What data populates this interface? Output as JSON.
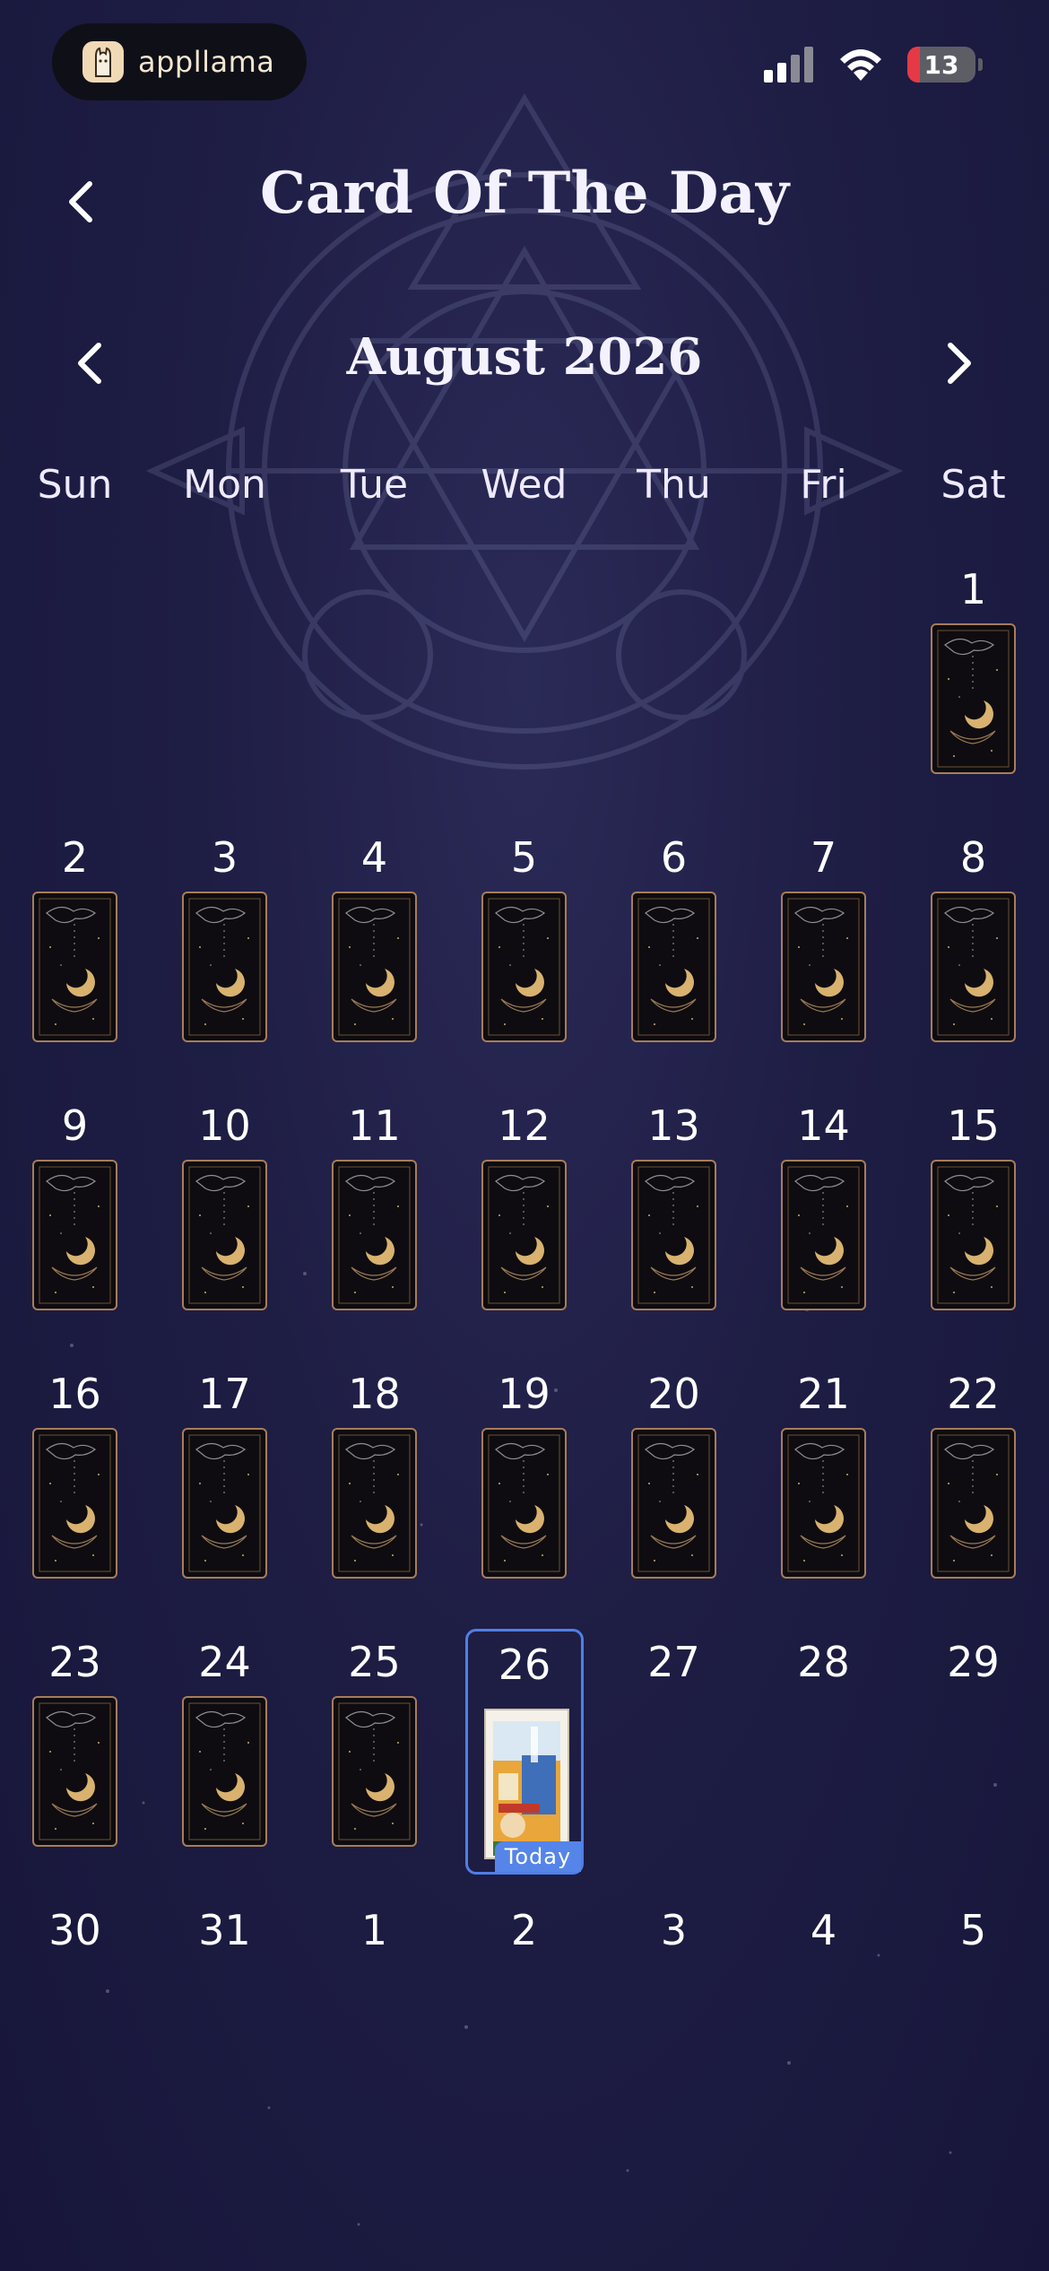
{
  "status_bar": {
    "brand": "appllama",
    "battery": "13"
  },
  "header": {
    "title": "Card Of The Day"
  },
  "calendar": {
    "month_label": "August 2026",
    "weekdays": [
      "Sun",
      "Mon",
      "Tue",
      "Wed",
      "Thu",
      "Fri",
      "Sat"
    ],
    "today_label": "Today",
    "today_date": "26",
    "colors": {
      "accent": "#4f7fe6",
      "today_badge": "#5585e8",
      "card_border": "#a77d58",
      "card_gold": "#d8b26e"
    },
    "weeks": [
      [
        {
          "day": "",
          "state": "empty"
        },
        {
          "day": "",
          "state": "empty"
        },
        {
          "day": "",
          "state": "empty"
        },
        {
          "day": "",
          "state": "empty"
        },
        {
          "day": "",
          "state": "empty"
        },
        {
          "day": "",
          "state": "empty"
        },
        {
          "day": "1",
          "state": "card"
        }
      ],
      [
        {
          "day": "2",
          "state": "card"
        },
        {
          "day": "3",
          "state": "card"
        },
        {
          "day": "4",
          "state": "card"
        },
        {
          "day": "5",
          "state": "card"
        },
        {
          "day": "6",
          "state": "card"
        },
        {
          "day": "7",
          "state": "card"
        },
        {
          "day": "8",
          "state": "card"
        }
      ],
      [
        {
          "day": "9",
          "state": "card"
        },
        {
          "day": "10",
          "state": "card"
        },
        {
          "day": "11",
          "state": "card"
        },
        {
          "day": "12",
          "state": "card"
        },
        {
          "day": "13",
          "state": "card"
        },
        {
          "day": "14",
          "state": "card"
        },
        {
          "day": "15",
          "state": "card"
        }
      ],
      [
        {
          "day": "16",
          "state": "card"
        },
        {
          "day": "17",
          "state": "card"
        },
        {
          "day": "18",
          "state": "card"
        },
        {
          "day": "19",
          "state": "card"
        },
        {
          "day": "20",
          "state": "card"
        },
        {
          "day": "21",
          "state": "card"
        },
        {
          "day": "22",
          "state": "card"
        }
      ],
      [
        {
          "day": "23",
          "state": "card"
        },
        {
          "day": "24",
          "state": "card"
        },
        {
          "day": "25",
          "state": "card"
        },
        {
          "day": "26",
          "state": "today"
        },
        {
          "day": "27",
          "state": "future"
        },
        {
          "day": "28",
          "state": "future"
        },
        {
          "day": "29",
          "state": "future"
        }
      ],
      [
        {
          "day": "30",
          "state": "future"
        },
        {
          "day": "31",
          "state": "future"
        },
        {
          "day": "1",
          "state": "future"
        },
        {
          "day": "2",
          "state": "future"
        },
        {
          "day": "3",
          "state": "future"
        },
        {
          "day": "4",
          "state": "future"
        },
        {
          "day": "5",
          "state": "future"
        }
      ]
    ]
  },
  "icons": {
    "back": "chevron-left-icon",
    "prev_month": "chevron-left-icon",
    "next_month": "chevron-right-icon",
    "signal": "cellular-signal-icon",
    "wifi": "wifi-icon",
    "battery": "battery-icon",
    "card_back": "crescent-moon-card-icon",
    "today_card": "tarot-card-icon"
  }
}
